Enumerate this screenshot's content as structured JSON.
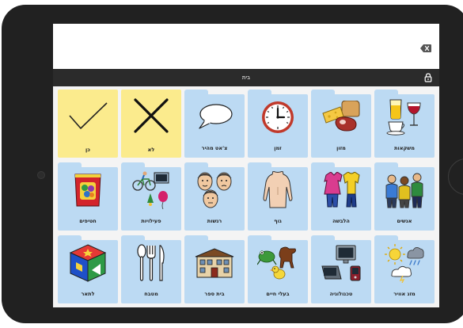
{
  "screen": {
    "title": "בית"
  },
  "grid": {
    "rows": [
      [
        {
          "label": "כן",
          "icon": "checkmark-icon",
          "kind": "yes"
        },
        {
          "label": "לא",
          "icon": "cross-icon",
          "kind": "no"
        },
        {
          "label": "צ'אט מהיר",
          "icon": "speech-bubble-icon",
          "kind": "folder"
        },
        {
          "label": "זמן",
          "icon": "clock-icon",
          "kind": "folder"
        },
        {
          "label": "מזון",
          "icon": "food-icon",
          "kind": "folder"
        },
        {
          "label": "משקאות",
          "icon": "drinks-icon",
          "kind": "folder"
        }
      ],
      [
        {
          "label": "חטיפים",
          "icon": "snacks-icon",
          "kind": "folder"
        },
        {
          "label": "פעילויות",
          "icon": "activities-icon",
          "kind": "folder"
        },
        {
          "label": "רגשות",
          "icon": "faces-icon",
          "kind": "folder"
        },
        {
          "label": "גוף",
          "icon": "body-icon",
          "kind": "folder"
        },
        {
          "label": "הלבשה",
          "icon": "clothing-icon",
          "kind": "folder"
        },
        {
          "label": "אנשים",
          "icon": "people-icon",
          "kind": "folder"
        }
      ],
      [
        {
          "label": "לתאר",
          "icon": "shapes-cube-icon",
          "kind": "folder"
        },
        {
          "label": "מטבח",
          "icon": "cutlery-icon",
          "kind": "folder"
        },
        {
          "label": "בית ספר",
          "icon": "school-icon",
          "kind": "folder"
        },
        {
          "label": "בעלי חיים",
          "icon": "animals-icon",
          "kind": "folder"
        },
        {
          "label": "טכנולוגיה",
          "icon": "computer-icon",
          "kind": "folder"
        },
        {
          "label": "מזג אוויר",
          "icon": "weather-icon",
          "kind": "folder"
        }
      ]
    ]
  }
}
